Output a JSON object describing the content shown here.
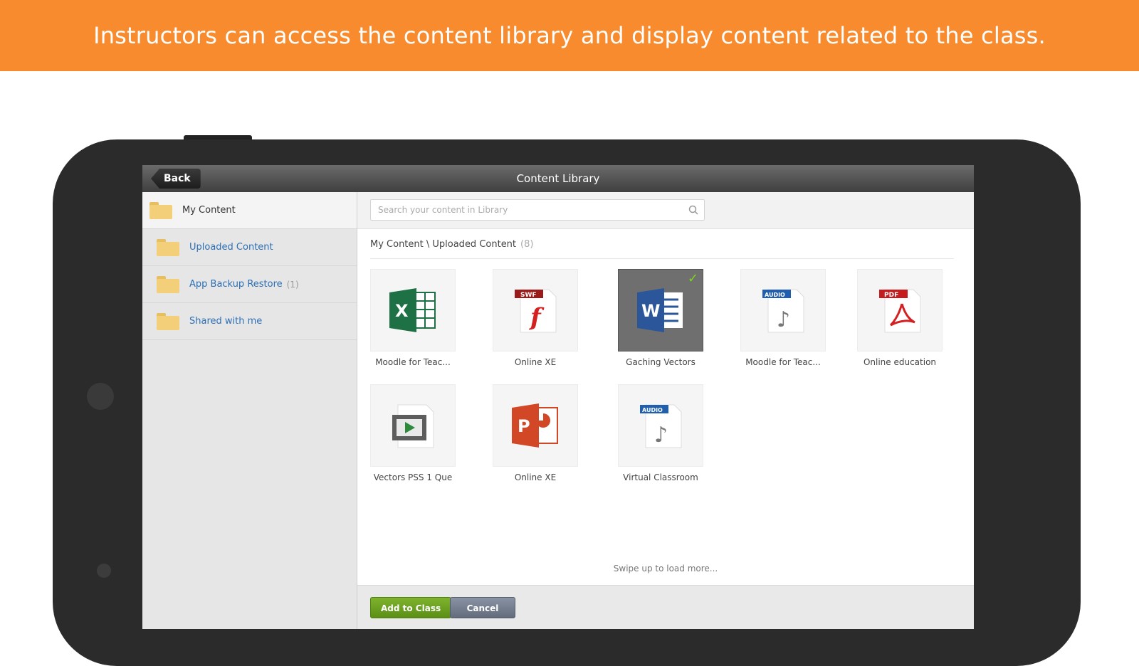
{
  "banner": {
    "text": "Instructors can access the content library and display content related to the class."
  },
  "titlebar": {
    "back_label": "Back",
    "title": "Content Library"
  },
  "sidebar": {
    "items": [
      {
        "label": "My Content",
        "count": ""
      },
      {
        "label": "Uploaded Content",
        "count": ""
      },
      {
        "label": "App Backup Restore",
        "count": "(1)"
      },
      {
        "label": "Shared with me",
        "count": ""
      }
    ]
  },
  "search": {
    "placeholder": "Search your content in Library"
  },
  "breadcrumb": {
    "path": "My Content \\ Uploaded Content",
    "count": "(8)"
  },
  "files": [
    {
      "label": "Moodle for Teac...",
      "icon": "excel-icon",
      "selected": false
    },
    {
      "label": "Online XE",
      "icon": "swf-icon",
      "selected": false
    },
    {
      "label": "Gaching Vectors",
      "icon": "word-icon",
      "selected": true
    },
    {
      "label": "Moodle for Teac...",
      "icon": "audio-icon",
      "selected": false
    },
    {
      "label": "Online education",
      "icon": "pdf-icon",
      "selected": false
    },
    {
      "label": "Vectors PSS 1 Que",
      "icon": "video-icon",
      "selected": false
    },
    {
      "label": "Online XE",
      "icon": "powerpoint-icon",
      "selected": false
    },
    {
      "label": "Virtual Classroom",
      "icon": "audio-icon",
      "selected": false
    }
  ],
  "load_more": "Swipe up to load more...",
  "footer": {
    "add_label": "Add to Class",
    "cancel_label": "Cancel"
  },
  "colors": {
    "banner": "#f98b2f",
    "add_button": "#6a9f22",
    "cancel_button": "#737c8c",
    "link": "#2b6fb6"
  }
}
